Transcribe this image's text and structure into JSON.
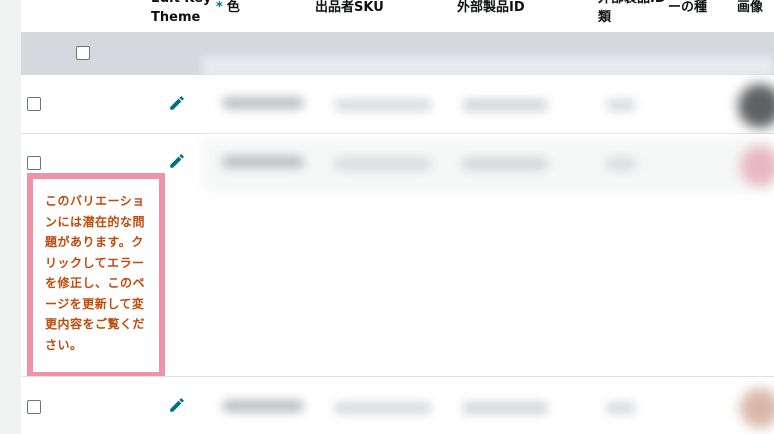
{
  "table": {
    "headers": {
      "edit_key_theme_top": "Edit Key",
      "edit_key_theme_bottom": "Theme",
      "color_required": "*",
      "color": "色",
      "seller_sku": "出品者SKU",
      "external_product_id": "外部製品ID",
      "external_product_type_top": "外部製品ID",
      "external_product_type_bottom": "類",
      "unknown_col": "ーの種",
      "image": "画像"
    }
  },
  "tooltip": {
    "message": "このバリエーションには潜在的な問題があります。クリックしてエラーを修正し、このページを更新して変更内容をご覧ください。"
  },
  "colors": {
    "accent": "#007185",
    "error_text": "#c14a0b",
    "tooltip_border": "#ee94a8",
    "filter_row": "#d5d9de"
  },
  "icons": {
    "edit": "pencil-icon"
  }
}
